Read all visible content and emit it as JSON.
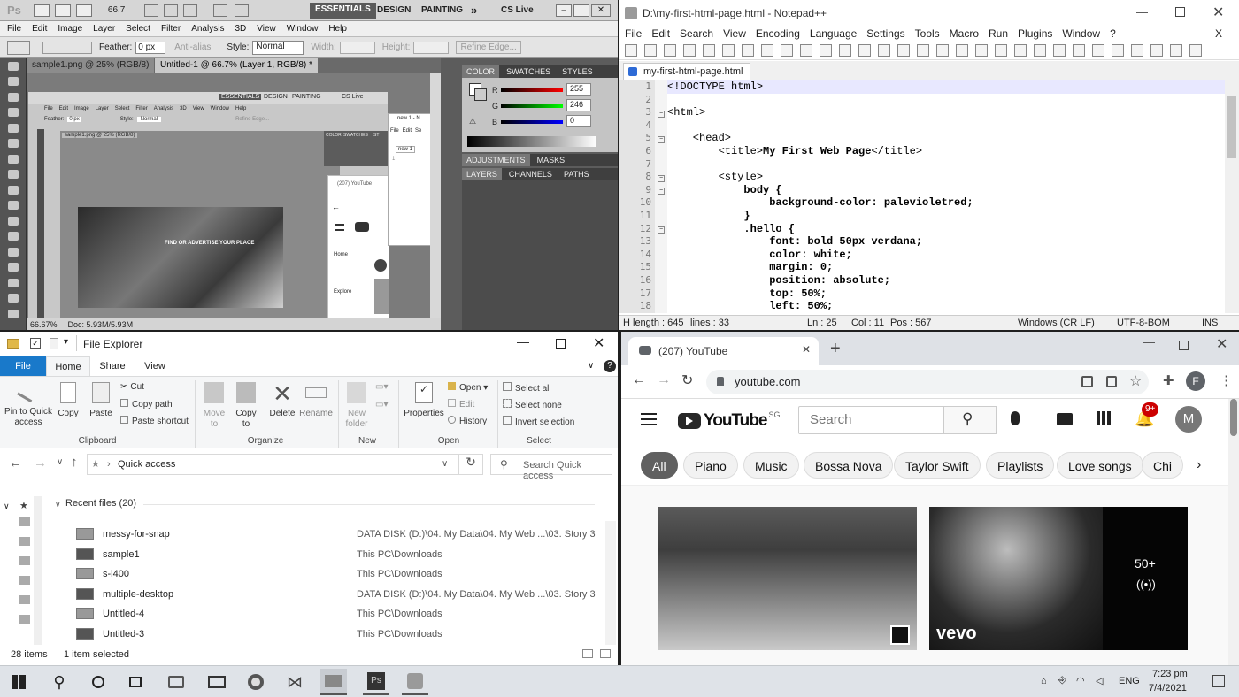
{
  "photoshop": {
    "title_left": "Ps",
    "zoom": "66.7",
    "workspaces": [
      "ESSENTIALS",
      "DESIGN",
      "PAINTING"
    ],
    "workspace_more": "»",
    "cslive": "CS Live",
    "menu": [
      "File",
      "Edit",
      "Image",
      "Layer",
      "Select",
      "Filter",
      "Analysis",
      "3D",
      "View",
      "Window",
      "Help"
    ],
    "options": {
      "feather_label": "Feather:",
      "feather_value": "0 px",
      "antialias": "Anti-alias",
      "style_label": "Style:",
      "style_value": "Normal",
      "width_label": "Width:",
      "height_label": "Height:",
      "refine": "Refine Edge..."
    },
    "tabs": [
      "sample1.png @ 25% (RGB/8)",
      "Untitled-1 @ 66.7% (Layer 1, RGB/8) *"
    ],
    "status": {
      "zoom": "66.67%",
      "doc": "Doc: 5.93M/5.93M"
    },
    "panels": {
      "color_tabs": [
        "COLOR",
        "SWATCHES",
        "STYLES"
      ],
      "r": "255",
      "g": "246",
      "b": "0",
      "r_label": "R",
      "g_label": "G",
      "b_label": "B",
      "adj_tabs": [
        "ADJUSTMENTS",
        "MASKS"
      ],
      "layer_tabs": [
        "LAYERS",
        "CHANNELS",
        "PATHS"
      ]
    },
    "nested": {
      "tab": "sample1.png @ 25% (RGB/8)",
      "mini_workspaces": [
        "ESSENTIALS",
        "DESIGN",
        "PAINTING"
      ],
      "mini_cslive": "CS Live",
      "mini_menu": [
        "File",
        "Edit",
        "Image",
        "Layer",
        "Select",
        "Filter",
        "Analysis",
        "3D",
        "View",
        "Window",
        "Help"
      ],
      "mini_feather": "Feather:",
      "mini_feather_val": "0 px",
      "mini_style": "Style:",
      "mini_style_val": "Normal",
      "mini_refine": "Refine Edge...",
      "mini_color_tabs": [
        "COLOR",
        "SWATCHES",
        "ST"
      ],
      "photo_text": "FIND OR ADVERTISE YOUR PLACE",
      "yt_tab": "(207) YouTube",
      "yt_home": "Home",
      "yt_explore": "Explore",
      "npp_tab": "new 1 - N",
      "npp_menu": [
        "File",
        "Edit",
        "Se"
      ],
      "npp_doc": "new 1",
      "npp_line": "1"
    }
  },
  "notepad": {
    "title": "D:\\my-first-html-page.html - Notepad++",
    "menu": [
      "File",
      "Edit",
      "Search",
      "View",
      "Encoding",
      "Language",
      "Settings",
      "Tools",
      "Macro",
      "Run",
      "Plugins",
      "Window",
      "?"
    ],
    "close_x": "X",
    "tab": "my-first-html-page.html",
    "lines": [
      "1",
      "2",
      "3",
      "4",
      "5",
      "6",
      "7",
      "8",
      "9",
      "10",
      "11",
      "12",
      "13",
      "14",
      "15",
      "16",
      "17",
      "18"
    ],
    "code": [
      {
        "pre": "<!DOCTYPE html>",
        "bold": "",
        "post": ""
      },
      {
        "pre": "",
        "bold": "",
        "post": ""
      },
      {
        "pre": "<html>",
        "bold": "",
        "post": ""
      },
      {
        "pre": "",
        "bold": "",
        "post": ""
      },
      {
        "pre": "    <head>",
        "bold": "",
        "post": ""
      },
      {
        "pre": "        <title>",
        "bold": "My First Web Page",
        "post": "</title>"
      },
      {
        "pre": "",
        "bold": "",
        "post": ""
      },
      {
        "pre": "        <style>",
        "bold": "",
        "post": ""
      },
      {
        "pre": "",
        "bold": "            body {",
        "post": ""
      },
      {
        "pre": "",
        "bold": "                background-color: palevioletred;",
        "post": ""
      },
      {
        "pre": "",
        "bold": "            }",
        "post": ""
      },
      {
        "pre": "",
        "bold": "            .hello {",
        "post": ""
      },
      {
        "pre": "",
        "bold": "                font: bold 50px verdana;",
        "post": ""
      },
      {
        "pre": "",
        "bold": "                color: white;",
        "post": ""
      },
      {
        "pre": "",
        "bold": "                margin: 0;",
        "post": ""
      },
      {
        "pre": "",
        "bold": "                position: absolute;",
        "post": ""
      },
      {
        "pre": "",
        "bold": "                top: 50%;",
        "post": ""
      },
      {
        "pre": "",
        "bold": "                left: 50%;",
        "post": ""
      }
    ],
    "status": {
      "length": "H length : 645",
      "lines": "lines : 33",
      "ln": "Ln : 25",
      "col": "Col : 11",
      "pos": "Pos : 567",
      "eol": "Windows (CR LF)",
      "enc": "UTF-8-BOM",
      "mode": "INS"
    }
  },
  "explorer": {
    "title": "File Explorer",
    "ribbon_tabs": [
      "File",
      "Home",
      "Share",
      "View"
    ],
    "help": "?",
    "clipboard": {
      "pin": "Pin to Quick access",
      "copy": "Copy",
      "paste": "Paste",
      "cut": "Cut",
      "copy_path": "Copy path",
      "paste_shortcut": "Paste shortcut",
      "label": "Clipboard"
    },
    "organize": {
      "move": "Move to",
      "copy": "Copy to",
      "delete": "Delete",
      "rename": "Rename",
      "label": "Organize"
    },
    "new": {
      "folder": "New folder",
      "label": "New"
    },
    "open": {
      "properties": "Properties",
      "open": "Open",
      "edit": "Edit",
      "history": "History",
      "label": "Open"
    },
    "select": {
      "all": "Select all",
      "none": "Select none",
      "invert": "Invert selection",
      "label": "Select"
    },
    "address": "Quick access",
    "search_placeholder": "Search Quick access",
    "section": "Recent files (20)",
    "files": [
      {
        "name": "messy-for-snap",
        "path": "DATA DISK (D:)\\04.  My Data\\04.  My Web ...\\03.  Story 3"
      },
      {
        "name": "sample1",
        "path": "This PC\\Downloads"
      },
      {
        "name": "s-l400",
        "path": "This PC\\Downloads"
      },
      {
        "name": "multiple-desktop",
        "path": "DATA DISK (D:)\\04.  My Data\\04.  My Web ...\\03.  Story 3"
      },
      {
        "name": "Untitled-4",
        "path": "This PC\\Downloads"
      },
      {
        "name": "Untitled-3",
        "path": "This PC\\Downloads"
      }
    ],
    "status": {
      "items": "28 items",
      "selected": "1 item selected"
    }
  },
  "chrome": {
    "tab_title": "(207) YouTube",
    "new_tab": "+",
    "url": "youtube.com",
    "profile": "F",
    "yt": {
      "logo": "YouTube",
      "region": "SG",
      "search_placeholder": "Search",
      "notif_count": "9+",
      "avatar": "M",
      "chips": [
        "All",
        "Piano",
        "Music",
        "Bossa Nova",
        "Taylor Swift",
        "Playlists",
        "Love songs",
        "Chi"
      ],
      "vevo": "vevo",
      "count": "50+"
    }
  },
  "taskbar": {
    "lang": "ENG",
    "time": "7:23 pm",
    "date": "7/4/2021"
  }
}
